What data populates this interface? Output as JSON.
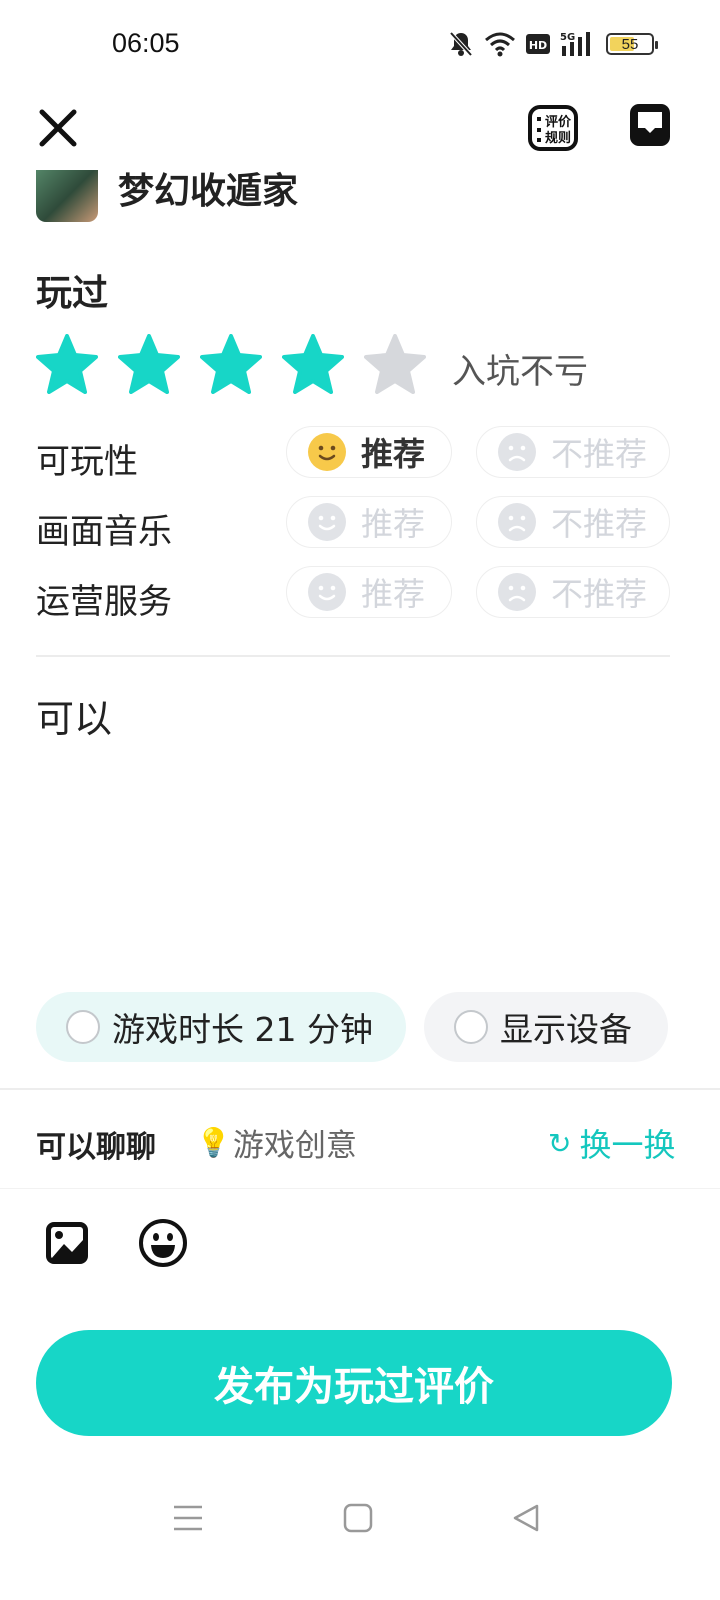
{
  "status_bar": {
    "time": "06:05",
    "battery": "55",
    "icons": [
      "bell-off-icon",
      "wifi-icon",
      "hd-icon",
      "signal-5g-icon",
      "battery-icon"
    ]
  },
  "top_bar": {
    "close_icon": "close-icon",
    "rules_label_line1": "评价",
    "rules_label_line2": "规则",
    "message_icon": "inbox-icon"
  },
  "game": {
    "title": "梦幻收遁家"
  },
  "rating": {
    "label": "玩过",
    "stars": 4,
    "max_stars": 5,
    "caption": "入坑不亏",
    "accent_color": "#17d6c7"
  },
  "aspects": [
    {
      "label": "可玩性",
      "recommend": "推荐",
      "not_recommend": "不推荐",
      "selected": "recommend"
    },
    {
      "label": "画面音乐",
      "recommend": "推荐",
      "not_recommend": "不推荐",
      "selected": "none"
    },
    {
      "label": "运营服务",
      "recommend": "推荐",
      "not_recommend": "不推荐",
      "selected": "none"
    }
  ],
  "review": {
    "text": "可以"
  },
  "tags": {
    "playtime": "游戏时长 21 分钟",
    "device": "显示设备"
  },
  "prompt": {
    "label": "可以聊聊",
    "topic": "游戏创意",
    "swap": "换一换"
  },
  "toolbar": {
    "image_icon": "image-icon",
    "emoji_icon": "emoji-icon"
  },
  "publish": {
    "label": "发布为玩过评价"
  },
  "nav": [
    "menu-icon",
    "home-icon",
    "back-icon"
  ]
}
